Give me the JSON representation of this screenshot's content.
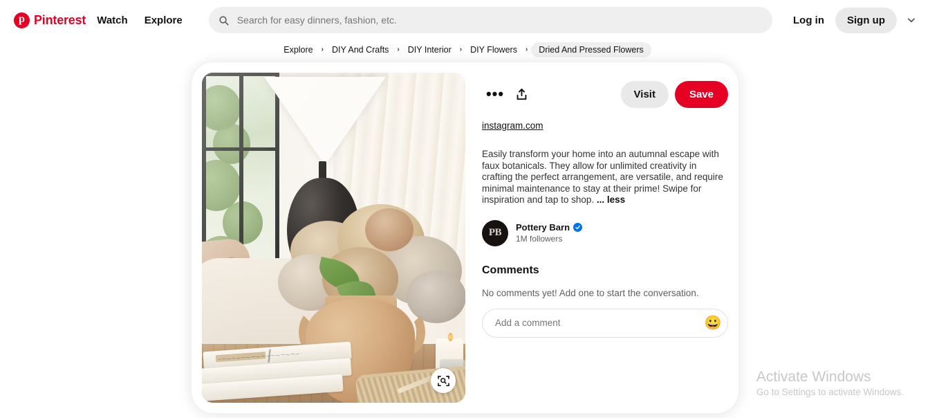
{
  "header": {
    "logo_text": "Pinterest",
    "logo_mark": "p",
    "logo_color": "#e60023",
    "nav": [
      {
        "label": "Watch"
      },
      {
        "label": "Explore"
      }
    ],
    "search": {
      "placeholder": "Search for easy dinners, fashion, etc.",
      "value": "",
      "icon": "search-icon"
    },
    "login_label": "Log in",
    "signup_label": "Sign up",
    "dropdown_icon": "chevron-down-icon"
  },
  "breadcrumb": {
    "separator": "›",
    "items": [
      {
        "label": "Explore",
        "current": false
      },
      {
        "label": "DIY And Crafts",
        "current": false
      },
      {
        "label": "DIY Interior",
        "current": false
      },
      {
        "label": "DIY Flowers",
        "current": false
      },
      {
        "label": "Dried And Pressed Flowers",
        "current": true
      }
    ]
  },
  "pin": {
    "image_alt": "Terracotta vase with dried hydrangeas on a wooden coffee table beside books, a woven tray and candle, with a black lamp and sunlit window behind",
    "lens_icon": "visual-search-icon",
    "actions": {
      "more_icon": "more-options-icon",
      "more_label": "•••",
      "share_icon": "share-icon",
      "visit_label": "Visit",
      "save_label": "Save",
      "save_color": "#e60023"
    },
    "source": "instagram.com",
    "description": "Easily transform your home into an autumnal escape with faux botanicals. They allow for unlimited creativity in crafting the perfect arrangement, are versatile, and require minimal maintenance to stay at their prime! Swipe for inspiration and tap to shop. ",
    "description_toggle": "... less",
    "profile": {
      "avatar_initials": "PB",
      "name": "Pottery Barn",
      "verified": true,
      "verified_icon": "verified-badge-icon",
      "followers": "1M followers"
    },
    "comments": {
      "title": "Comments",
      "empty_text": "No comments yet! Add one to start the conversation.",
      "input_placeholder": "Add a comment",
      "input_value": "",
      "emoji_icon": "emoji-smiley-icon",
      "emoji_glyph": "😀"
    }
  },
  "watermark": {
    "title": "Activate Windows",
    "subtitle": "Go to Settings to activate Windows."
  }
}
